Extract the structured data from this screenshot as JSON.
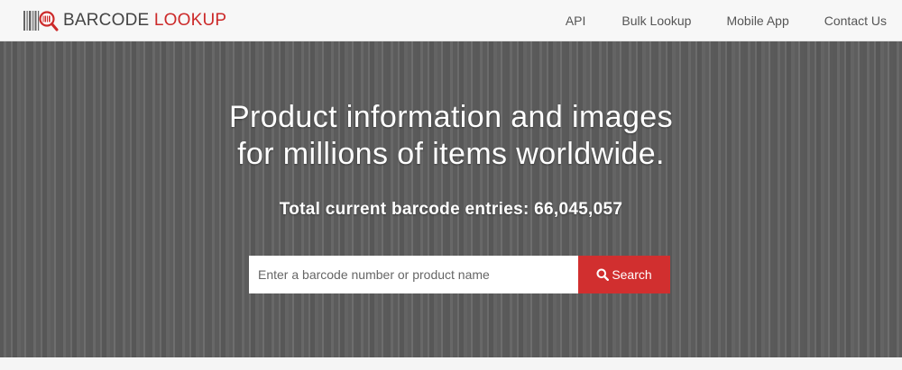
{
  "header": {
    "logo": {
      "word1": "BARCODE",
      "word2": "LOOKUP"
    },
    "nav": [
      {
        "label": "API"
      },
      {
        "label": "Bulk Lookup"
      },
      {
        "label": "Mobile App"
      },
      {
        "label": "Contact Us"
      }
    ]
  },
  "hero": {
    "headline_line1": "Product information and images",
    "headline_line2": "for millions of items worldwide.",
    "count_text": "Total current barcode entries: 66,045,057"
  },
  "search": {
    "placeholder": "Enter a barcode number or product name",
    "value": "",
    "button_label": "Search",
    "icon": "search-icon"
  },
  "colors": {
    "brand_red": "#cc2a2a",
    "button_red": "#d12f2f",
    "hero_gray": "#5f5f5f",
    "nav_bg": "#f7f7f7"
  }
}
